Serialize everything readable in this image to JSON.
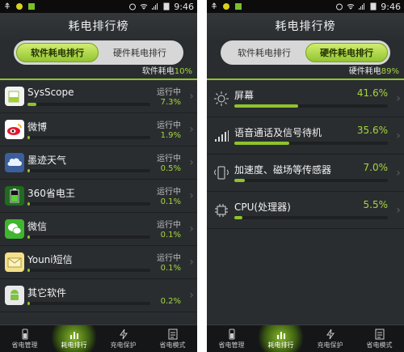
{
  "status": {
    "time": "9:46"
  },
  "left": {
    "title": "耗电排行榜",
    "tabs": [
      {
        "label": "软件耗电排行",
        "active": true
      },
      {
        "label": "硬件耗电排行",
        "active": false
      }
    ],
    "summary_label": "软件耗电",
    "summary_pct": "10%",
    "apps": [
      {
        "name": "SysScope",
        "state": "运行中",
        "pct": "7.3%",
        "value": 7.3,
        "icon": "sysscope-icon"
      },
      {
        "name": "微博",
        "state": "运行中",
        "pct": "1.9%",
        "value": 1.9,
        "icon": "weibo-icon"
      },
      {
        "name": "墨迹天气",
        "state": "运行中",
        "pct": "0.5%",
        "value": 0.5,
        "icon": "weather-icon"
      },
      {
        "name": "360省电王",
        "state": "运行中",
        "pct": "0.1%",
        "value": 0.1,
        "icon": "battery-app-icon"
      },
      {
        "name": "微信",
        "state": "运行中",
        "pct": "0.1%",
        "value": 0.1,
        "icon": "wechat-icon"
      },
      {
        "name": "Youni短信",
        "state": "运行中",
        "pct": "0.1%",
        "value": 0.1,
        "icon": "message-icon"
      },
      {
        "name": "其它软件",
        "state": "",
        "pct": "0.2%",
        "value": 0.2,
        "icon": "android-icon"
      }
    ],
    "nav": [
      {
        "label": "省电管理"
      },
      {
        "label": "耗电排行",
        "active": true
      },
      {
        "label": "充电保护"
      },
      {
        "label": "省电模式"
      }
    ]
  },
  "right": {
    "title": "耗电排行榜",
    "tabs": [
      {
        "label": "软件耗电排行",
        "active": false
      },
      {
        "label": "硬件耗电排行",
        "active": true
      }
    ],
    "summary_label": "硬件耗电",
    "summary_pct": "89%",
    "items": [
      {
        "name": "屏幕",
        "pct": "41.6%",
        "value": 41.6,
        "icon": "brightness-icon"
      },
      {
        "name": "语音通话及信号待机",
        "pct": "35.6%",
        "value": 35.6,
        "icon": "signal-icon"
      },
      {
        "name": "加速度、磁场等传感器",
        "pct": "7.0%",
        "value": 7.0,
        "icon": "sensor-icon"
      },
      {
        "name": "CPU(处理器)",
        "pct": "5.5%",
        "value": 5.5,
        "icon": "cpu-icon"
      }
    ],
    "nav": [
      {
        "label": "省电管理"
      },
      {
        "label": "耗电排行",
        "active": true
      },
      {
        "label": "充电保护"
      },
      {
        "label": "省电模式"
      }
    ]
  },
  "colors": {
    "accent": "#8fc32d",
    "background": "#2a2d30",
    "pct_text": "#a5d63a"
  }
}
